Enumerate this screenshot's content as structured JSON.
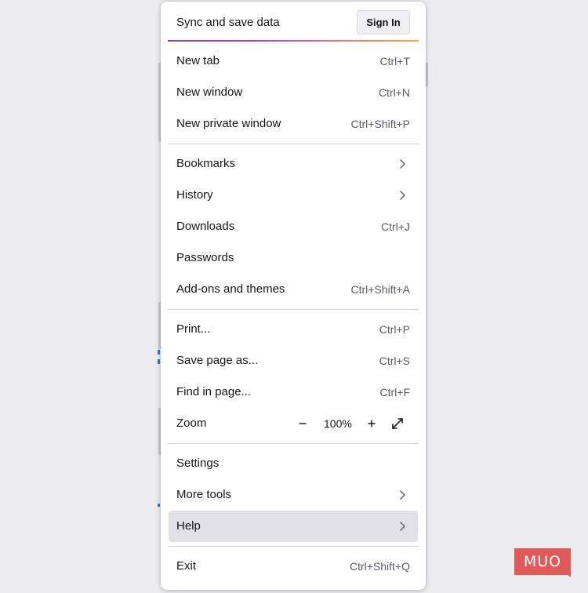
{
  "header": {
    "title": "Sync and save data",
    "signin_label": "Sign In"
  },
  "items": {
    "new_tab": {
      "label": "New tab",
      "shortcut": "Ctrl+T"
    },
    "new_window": {
      "label": "New window",
      "shortcut": "Ctrl+N"
    },
    "new_private_window": {
      "label": "New private window",
      "shortcut": "Ctrl+Shift+P"
    },
    "bookmarks": {
      "label": "Bookmarks",
      "icon": "chevron-right-icon"
    },
    "history": {
      "label": "History",
      "icon": "chevron-right-icon"
    },
    "downloads": {
      "label": "Downloads",
      "shortcut": "Ctrl+J"
    },
    "passwords": {
      "label": "Passwords"
    },
    "addons": {
      "label": "Add-ons and themes",
      "shortcut": "Ctrl+Shift+A"
    },
    "print": {
      "label": "Print...",
      "shortcut": "Ctrl+P"
    },
    "save_page": {
      "label": "Save page as...",
      "shortcut": "Ctrl+S"
    },
    "find_in_page": {
      "label": "Find in page...",
      "shortcut": "Ctrl+F"
    },
    "zoom": {
      "label": "Zoom",
      "level": "100%",
      "minus_icon": "minus-icon",
      "plus_icon": "plus-icon",
      "fullscreen_icon": "fullscreen-icon"
    },
    "settings": {
      "label": "Settings"
    },
    "more_tools": {
      "label": "More tools",
      "icon": "chevron-right-icon"
    },
    "help": {
      "label": "Help",
      "icon": "chevron-right-icon",
      "highlighted": true
    },
    "exit": {
      "label": "Exit",
      "shortcut": "Ctrl+Shift+Q"
    }
  },
  "watermark": {
    "text": "MUO"
  },
  "colors": {
    "menu_bg": "#ffffff",
    "hover_bg": "#e0e0e6",
    "text": "#15141a",
    "shortcut_text": "#5b5b66",
    "separator": "#cfcfd8",
    "watermark_bg": "#e05a59"
  }
}
